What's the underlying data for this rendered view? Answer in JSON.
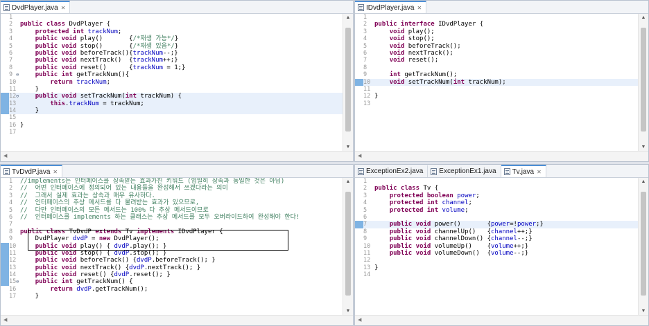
{
  "panes": [
    {
      "tabs": [
        {
          "label": "DvdPlayer.java",
          "active": true
        }
      ],
      "lines": [
        {
          "n": "1",
          "segs": []
        },
        {
          "n": "2",
          "segs": [
            [
              "kw",
              "public class "
            ],
            [
              "",
              "DvdPlayer {"
            ]
          ]
        },
        {
          "n": "3",
          "segs": [
            [
              "",
              "    "
            ],
            [
              "kw",
              "protected int "
            ],
            [
              "fld",
              "trackNum"
            ],
            [
              "",
              ";"
            ]
          ]
        },
        {
          "n": "4",
          "segs": [
            [
              "",
              "    "
            ],
            [
              "kw",
              "public void "
            ],
            [
              "",
              "play()       {"
            ],
            [
              "cm",
              "/*재생 가능*/"
            ],
            [
              "",
              "}"
            ]
          ]
        },
        {
          "n": "5",
          "segs": [
            [
              "",
              "    "
            ],
            [
              "kw",
              "public void "
            ],
            [
              "",
              "stop()       {"
            ],
            [
              "cm",
              "/*재생 있음*/"
            ],
            [
              "",
              "}"
            ]
          ]
        },
        {
          "n": "6",
          "segs": [
            [
              "",
              "    "
            ],
            [
              "kw",
              "public void "
            ],
            [
              "",
              "beforeTrack(){"
            ],
            [
              "fld",
              "trackNum"
            ],
            [
              "",
              "--;}"
            ]
          ]
        },
        {
          "n": "7",
          "segs": [
            [
              "",
              "    "
            ],
            [
              "kw",
              "public void "
            ],
            [
              "",
              "nextTrack()  {"
            ],
            [
              "fld",
              "trackNum"
            ],
            [
              "",
              "++;}"
            ]
          ]
        },
        {
          "n": "8",
          "segs": [
            [
              "",
              "    "
            ],
            [
              "kw",
              "public void "
            ],
            [
              "",
              "reset()      {"
            ],
            [
              "fld",
              "trackNum"
            ],
            [
              "",
              " = 1;}"
            ]
          ]
        },
        {
          "n": "9",
          "fold": "⊖",
          "segs": [
            [
              "",
              "    "
            ],
            [
              "kw",
              "public int "
            ],
            [
              "",
              "getTrackNum(){"
            ]
          ]
        },
        {
          "n": "10",
          "segs": [
            [
              "",
              "        "
            ],
            [
              "kw",
              "return "
            ],
            [
              "fld",
              "trackNum"
            ],
            [
              "",
              ";"
            ]
          ]
        },
        {
          "n": "11",
          "segs": [
            [
              "",
              "    }"
            ]
          ]
        },
        {
          "n": "12",
          "fold": "⊖",
          "mark": true,
          "hl": true,
          "segs": [
            [
              "",
              "    "
            ],
            [
              "kw",
              "public void "
            ],
            [
              "",
              "setTrackNum("
            ],
            [
              "kw",
              "int "
            ],
            [
              "",
              "trackNum) {"
            ]
          ]
        },
        {
          "n": "13",
          "mark": true,
          "hl": true,
          "segs": [
            [
              "",
              "        "
            ],
            [
              "kw",
              "this"
            ],
            [
              "",
              "."
            ],
            [
              "fld",
              "trackNum"
            ],
            [
              "",
              " = trackNum;"
            ]
          ]
        },
        {
          "n": "14",
          "mark": true,
          "hl": true,
          "segs": [
            [
              "",
              "    }"
            ]
          ]
        },
        {
          "n": "15",
          "segs": []
        },
        {
          "n": "16",
          "segs": [
            [
              "",
              "}"
            ]
          ]
        },
        {
          "n": "17",
          "segs": []
        }
      ]
    },
    {
      "tabs": [
        {
          "label": "IDvdPlayer.java",
          "active": true
        }
      ],
      "lines": [
        {
          "n": "1",
          "segs": []
        },
        {
          "n": "2",
          "segs": [
            [
              "kw",
              "public interface "
            ],
            [
              "",
              "IDvdPlayer {"
            ]
          ]
        },
        {
          "n": "3",
          "segs": [
            [
              "",
              "    "
            ],
            [
              "kw",
              "void "
            ],
            [
              "",
              "play();"
            ]
          ]
        },
        {
          "n": "4",
          "segs": [
            [
              "",
              "    "
            ],
            [
              "kw",
              "void "
            ],
            [
              "",
              "stop();"
            ]
          ]
        },
        {
          "n": "5",
          "segs": [
            [
              "",
              "    "
            ],
            [
              "kw",
              "void "
            ],
            [
              "",
              "beforeTrack();"
            ]
          ]
        },
        {
          "n": "6",
          "segs": [
            [
              "",
              "    "
            ],
            [
              "kw",
              "void "
            ],
            [
              "",
              "nextTrack();"
            ]
          ]
        },
        {
          "n": "7",
          "segs": [
            [
              "",
              "    "
            ],
            [
              "kw",
              "void "
            ],
            [
              "",
              "reset();"
            ]
          ]
        },
        {
          "n": "8",
          "segs": []
        },
        {
          "n": "9",
          "segs": [
            [
              "",
              "    "
            ],
            [
              "kw",
              "int "
            ],
            [
              "",
              "getTrackNum();"
            ]
          ]
        },
        {
          "n": "10",
          "mark": true,
          "hl": true,
          "segs": [
            [
              "",
              "    "
            ],
            [
              "kw",
              "void "
            ],
            [
              "",
              "setTrackNum("
            ],
            [
              "kw",
              "int "
            ],
            [
              "",
              "trackNum);"
            ]
          ]
        },
        {
          "n": "11",
          "segs": []
        },
        {
          "n": "12",
          "segs": [
            [
              "",
              "}"
            ]
          ]
        },
        {
          "n": "13",
          "segs": []
        }
      ]
    },
    {
      "tabs": [
        {
          "label": "TvDvdP.java",
          "active": true
        }
      ],
      "lines": [
        {
          "n": "1",
          "segs": [
            [
              "cm",
              "//implements는 인터페이스를 상속받는 효과가진 키워드 (엄밀히 상속과 동일한 것은 아님)"
            ]
          ]
        },
        {
          "n": "2",
          "segs": [
            [
              "cm",
              "//  어떤 인터페이스에 정의되어 있는 내용들을 완성해서 쓰겠다라는 의미"
            ]
          ]
        },
        {
          "n": "3",
          "segs": [
            [
              "cm",
              "//  그래서 실제 효과는 상속과 매우 유사하다."
            ]
          ]
        },
        {
          "n": "4",
          "segs": [
            [
              "cm",
              "//  인터페이스의 추상 메서드를 다 물려받는 효과가 있으므로,"
            ]
          ]
        },
        {
          "n": "5",
          "segs": [
            [
              "cm",
              "//  다만 인터페이스의 모든 메서드는 100% 다 추상 메서드이므로"
            ]
          ]
        },
        {
          "n": "6",
          "segs": [
            [
              "cm",
              "//  인터페이스를 implements 하는 클래스는 추상 메서드를 모두 오버라이드하여 완성해야 한다!"
            ]
          ]
        },
        {
          "n": "7",
          "segs": []
        },
        {
          "n": "8",
          "segs": [
            [
              "kw",
              "public class "
            ],
            [
              "",
              "TvDvdP "
            ],
            [
              "kw",
              "extends "
            ],
            [
              "",
              "Tv "
            ],
            [
              "kw",
              "implements "
            ],
            [
              "",
              "IDvdPlayer {"
            ]
          ]
        },
        {
          "n": "9",
          "segs": [
            [
              "",
              "    DvdPlayer "
            ],
            [
              "fld",
              "dvdP"
            ],
            [
              "",
              " = "
            ],
            [
              "kw",
              "new "
            ],
            [
              "",
              "DvdPlayer();"
            ]
          ]
        },
        {
          "n": "10",
          "mark": true,
          "segs": [
            [
              "",
              "    "
            ],
            [
              "kw",
              "public void "
            ],
            [
              "",
              "play() { "
            ],
            [
              "fld",
              "dvdP"
            ],
            [
              "",
              ".play(); }"
            ]
          ]
        },
        {
          "n": "11",
          "mark": true,
          "segs": [
            [
              "",
              "    "
            ],
            [
              "kw",
              "public void "
            ],
            [
              "",
              "stop() { "
            ],
            [
              "fld",
              "dvdP"
            ],
            [
              "",
              ".stop(); }"
            ]
          ]
        },
        {
          "n": "12",
          "mark": true,
          "segs": [
            [
              "",
              "    "
            ],
            [
              "kw",
              "public void "
            ],
            [
              "",
              "beforeTrack() {"
            ],
            [
              "fld",
              "dvdP"
            ],
            [
              "",
              ".beforeTrack(); }"
            ]
          ]
        },
        {
          "n": "13",
          "mark": true,
          "segs": [
            [
              "",
              "    "
            ],
            [
              "kw",
              "public void "
            ],
            [
              "",
              "nextTrack() {"
            ],
            [
              "fld",
              "dvdP"
            ],
            [
              "",
              ".nextTrack(); }"
            ]
          ]
        },
        {
          "n": "14",
          "mark": true,
          "segs": [
            [
              "",
              "    "
            ],
            [
              "kw",
              "public void "
            ],
            [
              "",
              "reset() {"
            ],
            [
              "fld",
              "dvdP"
            ],
            [
              "",
              ".reset(); }"
            ]
          ]
        },
        {
          "n": "15",
          "fold": "⊖",
          "mark": true,
          "segs": [
            [
              "",
              "    "
            ],
            [
              "kw",
              "public int "
            ],
            [
              "",
              "getTrackNum() {"
            ]
          ]
        },
        {
          "n": "16",
          "segs": [
            [
              "",
              "        "
            ],
            [
              "kw",
              "return "
            ],
            [
              "fld",
              "dvdP"
            ],
            [
              "",
              ".getTrackNum();"
            ]
          ]
        },
        {
          "n": "17",
          "segs": [
            [
              "",
              "    }"
            ]
          ]
        }
      ]
    },
    {
      "tabs": [
        {
          "label": "ExceptionEx2.java",
          "active": false
        },
        {
          "label": "ExceptionEx1.java",
          "active": false
        },
        {
          "label": "Tv.java",
          "active": true
        }
      ],
      "lines": [
        {
          "n": "1",
          "segs": []
        },
        {
          "n": "2",
          "segs": [
            [
              "kw",
              "public class "
            ],
            [
              "",
              "Tv {"
            ]
          ]
        },
        {
          "n": "3",
          "segs": [
            [
              "",
              "    "
            ],
            [
              "kw",
              "protected boolean "
            ],
            [
              "fld",
              "power"
            ],
            [
              "",
              ";"
            ]
          ]
        },
        {
          "n": "4",
          "segs": [
            [
              "",
              "    "
            ],
            [
              "kw",
              "protected int "
            ],
            [
              "fld",
              "channel"
            ],
            [
              "",
              ";"
            ]
          ]
        },
        {
          "n": "5",
          "segs": [
            [
              "",
              "    "
            ],
            [
              "kw",
              "protected int "
            ],
            [
              "fld",
              "volume"
            ],
            [
              "",
              ";"
            ]
          ]
        },
        {
          "n": "6",
          "segs": []
        },
        {
          "n": "7",
          "mark": true,
          "hl": true,
          "segs": [
            [
              "",
              "    "
            ],
            [
              "kw",
              "public void "
            ],
            [
              "",
              "power()       {"
            ],
            [
              "fld",
              "power"
            ],
            [
              "",
              "=!"
            ],
            [
              "fld",
              "power"
            ],
            [
              "",
              ";}"
            ]
          ]
        },
        {
          "n": "8",
          "segs": [
            [
              "",
              "    "
            ],
            [
              "kw",
              "public void "
            ],
            [
              "",
              "channelUp()   {"
            ],
            [
              "fld",
              "channel"
            ],
            [
              "",
              "++;}"
            ]
          ]
        },
        {
          "n": "9",
          "segs": [
            [
              "",
              "    "
            ],
            [
              "kw",
              "public void "
            ],
            [
              "",
              "channelDown() {"
            ],
            [
              "fld",
              "channel"
            ],
            [
              "",
              "--;}"
            ]
          ]
        },
        {
          "n": "10",
          "segs": [
            [
              "",
              "    "
            ],
            [
              "kw",
              "public void "
            ],
            [
              "",
              "volumeUp()    {"
            ],
            [
              "fld",
              "volume"
            ],
            [
              "",
              "++;}"
            ]
          ]
        },
        {
          "n": "11",
          "segs": [
            [
              "",
              "    "
            ],
            [
              "kw",
              "public void "
            ],
            [
              "",
              "volumeDown()  {"
            ],
            [
              "fld",
              "volume"
            ],
            [
              "",
              "--;}"
            ]
          ]
        },
        {
          "n": "12",
          "segs": []
        },
        {
          "n": "13",
          "segs": [
            [
              "",
              "}"
            ]
          ]
        },
        {
          "n": "14",
          "segs": []
        }
      ]
    }
  ]
}
